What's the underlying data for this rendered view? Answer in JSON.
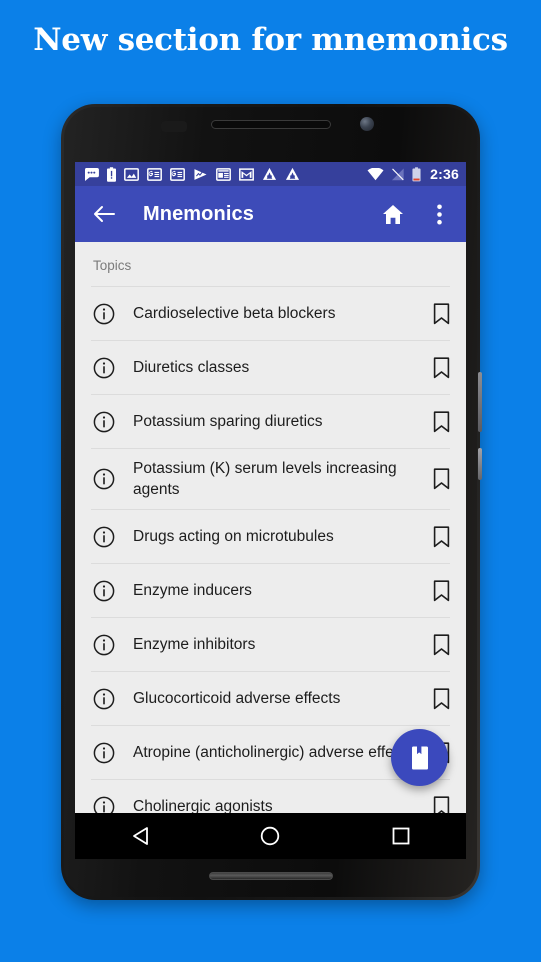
{
  "promo": {
    "headline": "New section for mnemonics",
    "background_color": "#0b80e8"
  },
  "statusbar": {
    "clock": "2:36",
    "left_icons": [
      "message-dots-icon",
      "battery-alert-icon",
      "photo-icon",
      "google-news-icon",
      "google-news-icon",
      "play-triangle-icon",
      "news-card-icon",
      "gmail-icon",
      "adguard-a-icon",
      "adguard-a-icon"
    ],
    "right_icons": [
      "wifi-icon",
      "signal-off-icon",
      "battery-low-icon"
    ],
    "background_color": "#36409c"
  },
  "appbar": {
    "title": "Mnemonics",
    "back_icon": "back-arrow-icon",
    "home_icon": "home-icon",
    "overflow_icon": "overflow-menu-icon",
    "background_color": "#3d4bb8"
  },
  "list": {
    "section_label": "Topics",
    "leading_icon": "info-circle-icon",
    "trailing_icon": "bookmark-outline-icon",
    "items": [
      {
        "title": "Cardioselective beta blockers"
      },
      {
        "title": "Diuretics classes"
      },
      {
        "title": "Potassium sparing diuretics"
      },
      {
        "title": "Potassium (K) serum levels increasing agents"
      },
      {
        "title": "Drugs acting on microtubules"
      },
      {
        "title": "Enzyme inducers"
      },
      {
        "title": "Enzyme inhibitors"
      },
      {
        "title": "Glucocorticoid adverse effects"
      },
      {
        "title": "Atropine (anticholinergic) adverse effects"
      },
      {
        "title": "Cholinergic agonists"
      }
    ]
  },
  "fab": {
    "icon": "bookmarked-book-icon",
    "color": "#3b49bd"
  },
  "navbar": {
    "back_icon": "nav-back-triangle-icon",
    "home_icon": "nav-home-circle-icon",
    "recents_icon": "nav-recents-square-icon"
  }
}
